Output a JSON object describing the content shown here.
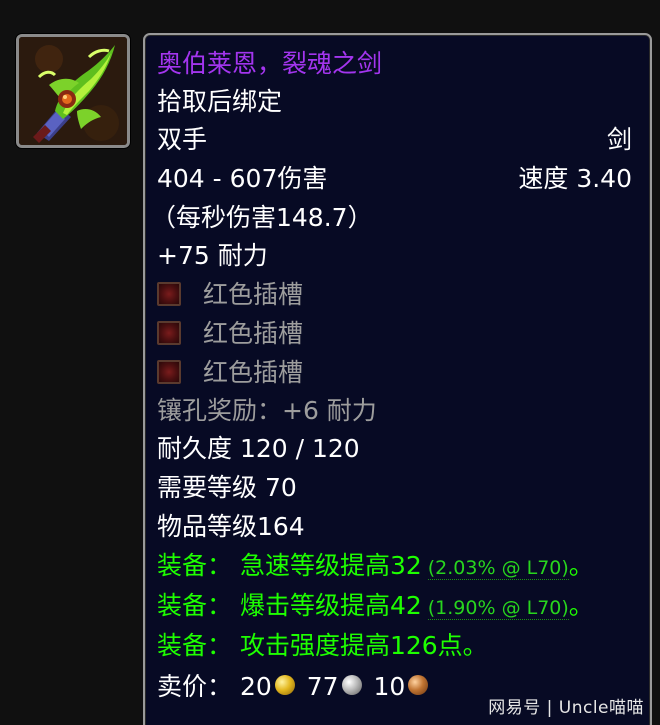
{
  "item_icon": {
    "icon": "green-crystal-sword-icon"
  },
  "tooltip": {
    "name": "奥伯莱恩，裂魂之剑",
    "bind": "拾取后绑定",
    "slot": "双手",
    "type": "剑",
    "damage": "404 - 607伤害",
    "speed": "速度 3.40",
    "dps": "（每秒伤害148.7）",
    "stamina": "+75 耐力",
    "sockets": [
      {
        "label": "红色插槽",
        "icon": "red-socket-icon"
      },
      {
        "label": "红色插槽",
        "icon": "red-socket-icon"
      },
      {
        "label": "红色插槽",
        "icon": "red-socket-icon"
      }
    ],
    "socket_bonus": "镶孔奖励：+6 耐力",
    "durability": "耐久度 120 / 120",
    "required_level": "需要等级 70",
    "item_level": "物品等级164",
    "equip_effects": [
      {
        "text": "装备：  急速等级提高32",
        "detail": "(2.03% @ L70)",
        "suffix": "。"
      },
      {
        "text": "装备：  爆击等级提高42",
        "detail": "(1.90% @ L70)",
        "suffix": "。"
      },
      {
        "text": "装备：  攻击强度提高126点。",
        "detail": "",
        "suffix": ""
      }
    ],
    "sell_price": {
      "label": "卖价：",
      "gold": "20",
      "silver": "77",
      "copper": "10"
    }
  },
  "colors": {
    "epic": "#a335ee",
    "uncommon": "#1eff00",
    "disabled": "#9d9d9d",
    "tooltip_bg": "#070a24"
  },
  "watermark": "网易号 | Uncle喵喵"
}
